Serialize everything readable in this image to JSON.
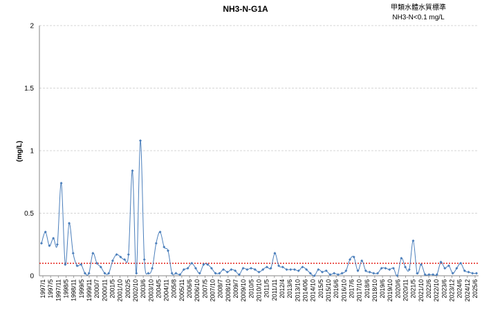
{
  "chart_data": {
    "type": "line",
    "title": "NH3-N-G1A",
    "annotation": [
      "甲類水體水質標準",
      "NH3-N<0.1 mg/L"
    ],
    "ylabel": "(mg/L)",
    "xlabel": "",
    "ylim": [
      0,
      2
    ],
    "yticks": [
      "0",
      "0.5",
      "1",
      "1.5",
      "2"
    ],
    "grid": "horizontal dashed",
    "standard_line": 0.1,
    "xtick_labels": [
      "1997/1",
      "1997/5",
      "1997/11",
      "1998/5",
      "1998/11",
      "1999/5",
      "1999/11",
      "2000/7",
      "2000/11",
      "2001/5",
      "2001/10",
      "2002/5",
      "2002/10",
      "2003/6",
      "2003/10",
      "2004/5",
      "2004/11",
      "2005/8",
      "2005/11",
      "2006/6",
      "2006/10",
      "2007/5",
      "2007/10",
      "2008/7",
      "2008/10",
      "2009/7",
      "2009/10",
      "2010/5",
      "2010/10",
      "2011/5",
      "2011/11",
      "2012/4",
      "2013/6",
      "2013/10",
      "2014/06",
      "2014/10",
      "2015/5",
      "2015/10",
      "2016/6",
      "2016/10",
      "2017/6",
      "2017/10",
      "2018/6",
      "2018/10",
      "2019/6",
      "2019/10",
      "2020/6",
      "2020/11",
      "2021/5",
      "2021/10",
      "2022/6",
      "2022/10",
      "2023/6",
      "2023/12",
      "2024/6",
      "2024/12",
      "2025/6"
    ],
    "series": [
      {
        "name": "",
        "color": "#4a7ebb",
        "values": [
          0.26,
          0.35,
          0.24,
          0.3,
          0.25,
          0.74,
          0.09,
          0.42,
          0.18,
          0.08,
          0.09,
          0.02,
          0.02,
          0.18,
          0.1,
          0.07,
          0.02,
          0.02,
          0.12,
          0.17,
          0.15,
          0.13,
          0.17,
          0.84,
          0.02,
          1.08,
          0.13,
          0.02,
          0.06,
          0.26,
          0.35,
          0.23,
          0.2,
          0.02,
          0.02,
          0.01,
          0.05,
          0.06,
          0.1,
          0.06,
          0.02,
          0.09,
          0.09,
          0.06,
          0.02,
          0.02,
          0.05,
          0.03,
          0.05,
          0.04,
          0.01,
          0.06,
          0.05,
          0.06,
          0.05,
          0.03,
          0.05,
          0.07,
          0.06,
          0.18,
          0.08,
          0.07,
          0.05,
          0.05,
          0.05,
          0.04,
          0.07,
          0.05,
          0.02,
          0.0,
          0.05,
          0.03,
          0.04,
          0.01,
          0.02,
          0.01,
          0.02,
          0.04,
          0.13,
          0.15,
          0.04,
          0.12,
          0.04,
          0.03,
          0.02,
          0.02,
          0.06,
          0.06,
          0.05,
          0.06,
          0.0,
          0.14,
          0.07,
          0.05,
          0.28,
          0.02,
          0.09,
          0.01,
          0.01,
          0.01,
          0.01,
          0.11,
          0.06,
          0.08,
          0.02,
          0.06,
          0.1,
          0.04,
          0.03,
          0.02,
          0.02
        ]
      }
    ]
  }
}
